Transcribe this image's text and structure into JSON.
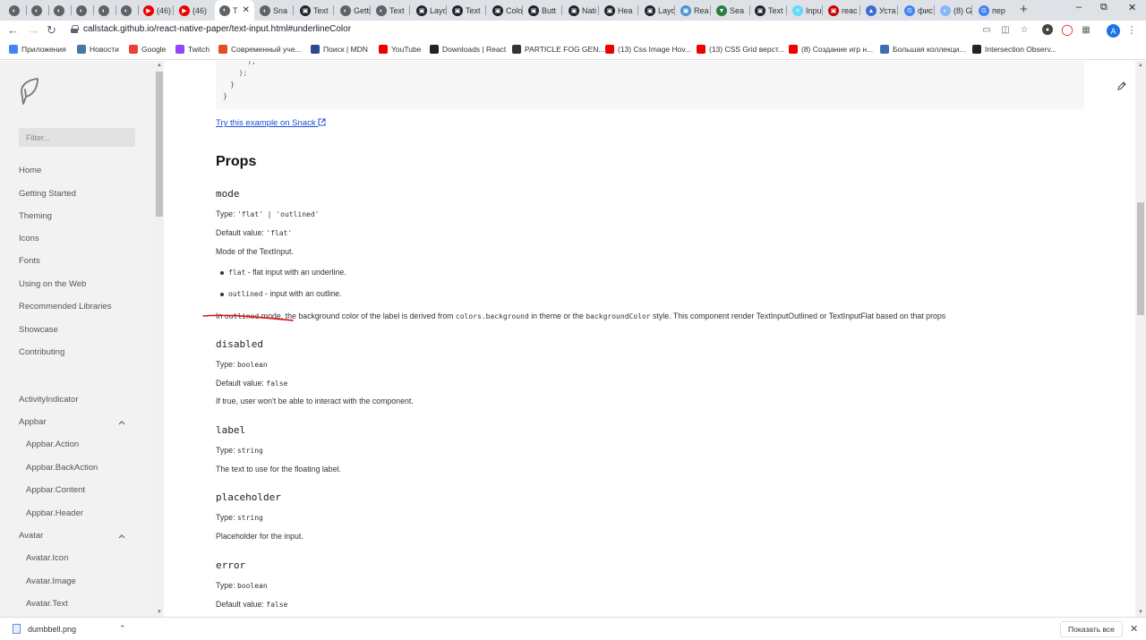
{
  "tabs": [
    {
      "label": "",
      "color": "#5f6368",
      "glyph": "◐"
    },
    {
      "label": "",
      "color": "#5f6368",
      "glyph": "◐"
    },
    {
      "label": "",
      "color": "#5f6368",
      "glyph": "◐"
    },
    {
      "label": "",
      "color": "#5f6368",
      "glyph": "◐"
    },
    {
      "label": "",
      "color": "#5f6368",
      "glyph": "◐"
    },
    {
      "label": "",
      "color": "#5f6368",
      "glyph": "◐"
    },
    {
      "label": "(46)",
      "color": "#e00",
      "glyph": "▶"
    },
    {
      "label": "(46)",
      "color": "#e00",
      "glyph": "▶"
    },
    {
      "label": "T",
      "color": "#5f6368",
      "glyph": "◐",
      "active": true
    },
    {
      "label": "Sna",
      "color": "#5f6368",
      "glyph": "◐"
    },
    {
      "label": "Text",
      "color": "#20232a",
      "glyph": "▣"
    },
    {
      "label": "Getti",
      "color": "#5f6368",
      "glyph": "◐"
    },
    {
      "label": "Text",
      "color": "#5f6368",
      "glyph": "◐"
    },
    {
      "label": "Layo",
      "color": "#20232a",
      "glyph": "▣"
    },
    {
      "label": "Text",
      "color": "#20232a",
      "glyph": "▣"
    },
    {
      "label": "Colo",
      "color": "#20232a",
      "glyph": "▣"
    },
    {
      "label": "Butt",
      "color": "#20232a",
      "glyph": "▣"
    },
    {
      "label": "Nati",
      "color": "#20232a",
      "glyph": "▣"
    },
    {
      "label": "Hea",
      "color": "#20232a",
      "glyph": "▣"
    },
    {
      "label": "Layo",
      "color": "#20232a",
      "glyph": "▣"
    },
    {
      "label": "Rea",
      "color": "#4a90d9",
      "glyph": "▣"
    },
    {
      "label": "Sea",
      "color": "#2a7d3e",
      "glyph": "▼"
    },
    {
      "label": "Text",
      "color": "#20232a",
      "glyph": "▣"
    },
    {
      "label": "Inpu",
      "color": "#61dafb",
      "glyph": "⚛"
    },
    {
      "label": "reac",
      "color": "#c00",
      "glyph": "▣"
    },
    {
      "label": "Уста",
      "color": "#3a6bd6",
      "glyph": "▲"
    },
    {
      "label": "фис",
      "color": "#4285f4",
      "glyph": "G"
    },
    {
      "label": "(8) G",
      "color": "#8ab4f8",
      "glyph": "◐"
    },
    {
      "label": "пер",
      "color": "#4285f4",
      "glyph": "G"
    }
  ],
  "toolbar": {
    "url": "callstack.github.io/react-native-paper/text-input.html#underlineColor",
    "profile_initial": "A"
  },
  "bookmarks": [
    {
      "label": "Приложения",
      "color": "#4285f4"
    },
    {
      "label": "Новости",
      "color": "#4c75a3"
    },
    {
      "label": "Google",
      "color": "#ea4335"
    },
    {
      "label": "Twitch",
      "color": "#9146ff"
    },
    {
      "label": "Современный уче...",
      "color": "#e44d26"
    },
    {
      "label": "Поиск | MDN",
      "color": "#2a4b8d"
    },
    {
      "label": "YouTube",
      "color": "#e00"
    },
    {
      "label": "Downloads | React",
      "color": "#20232a"
    },
    {
      "label": "PARTICLE FOG GEN...",
      "color": "#333"
    },
    {
      "label": "(13) Css Image Hov...",
      "color": "#e00"
    },
    {
      "label": "(13) CSS Grid верст...",
      "color": "#e00"
    },
    {
      "label": "(8) Создание игр н...",
      "color": "#e00"
    },
    {
      "label": "Большая коллекци...",
      "color": "#3c6eb4"
    },
    {
      "label": "Intersection Observ...",
      "color": "#20232a"
    }
  ],
  "sidebar": {
    "filter_placeholder": "Filter...",
    "items": [
      {
        "label": "Home"
      },
      {
        "label": "Getting Started"
      },
      {
        "label": "Theming"
      },
      {
        "label": "Icons"
      },
      {
        "label": "Fonts"
      },
      {
        "label": "Using on the Web"
      },
      {
        "label": "Recommended Libraries"
      },
      {
        "label": "Showcase"
      },
      {
        "label": "Contributing"
      },
      {
        "label": "ActivityIndicator"
      },
      {
        "label": "Appbar"
      },
      {
        "label": "Appbar.Action"
      },
      {
        "label": "Appbar.BackAction"
      },
      {
        "label": "Appbar.Content"
      },
      {
        "label": "Appbar.Header"
      },
      {
        "label": "Avatar"
      },
      {
        "label": "Avatar.Icon"
      },
      {
        "label": "Avatar.Image"
      },
      {
        "label": "Avatar.Text"
      }
    ]
  },
  "content": {
    "code_lines": [
      "    );",
      "  );",
      "}",
      "}"
    ],
    "snack_link": "Try this example on Snack",
    "props_heading": "Props",
    "mode": {
      "name": "mode",
      "type_label": "Type: ",
      "type_value": "'flat' | 'outlined'",
      "default_label": "Default value: ",
      "default_value": "'flat'",
      "description": "Mode of the TextInput.",
      "bullets": [
        {
          "code": "flat",
          "text": " - flat input with an underline."
        },
        {
          "code": "outlined",
          "text": " - input with an outline."
        }
      ],
      "note_parts": [
        "In ",
        "outlined",
        " mode, the background color of the label is derived from ",
        "colors.background",
        " in theme or the ",
        "backgroundColor",
        " style. This component render TextInputOutlined or TextInputFlat based on that props"
      ]
    },
    "disabled": {
      "name": "disabled",
      "type_label": "Type: ",
      "type_value": "boolean",
      "default_label": "Default value: ",
      "default_value": "false",
      "description": "If true, user won't be able to interact with the component."
    },
    "label": {
      "name": "label",
      "type_label": "Type: ",
      "type_value": "string",
      "description": "The text to use for the floating label."
    },
    "placeholder": {
      "name": "placeholder",
      "type_label": "Type: ",
      "type_value": "string",
      "description": "Placeholder for the input."
    },
    "error": {
      "name": "error",
      "type_label": "Type: ",
      "type_value": "boolean",
      "default_label": "Default value: ",
      "default_value": "false"
    }
  },
  "downloads": {
    "file_name": "dumbbell.png",
    "show_all": "Показать все"
  },
  "colors": {
    "link": "#1b4ed8",
    "annotation_underline": "#d11",
    "sidebar_bg": "#f2f2f2"
  }
}
